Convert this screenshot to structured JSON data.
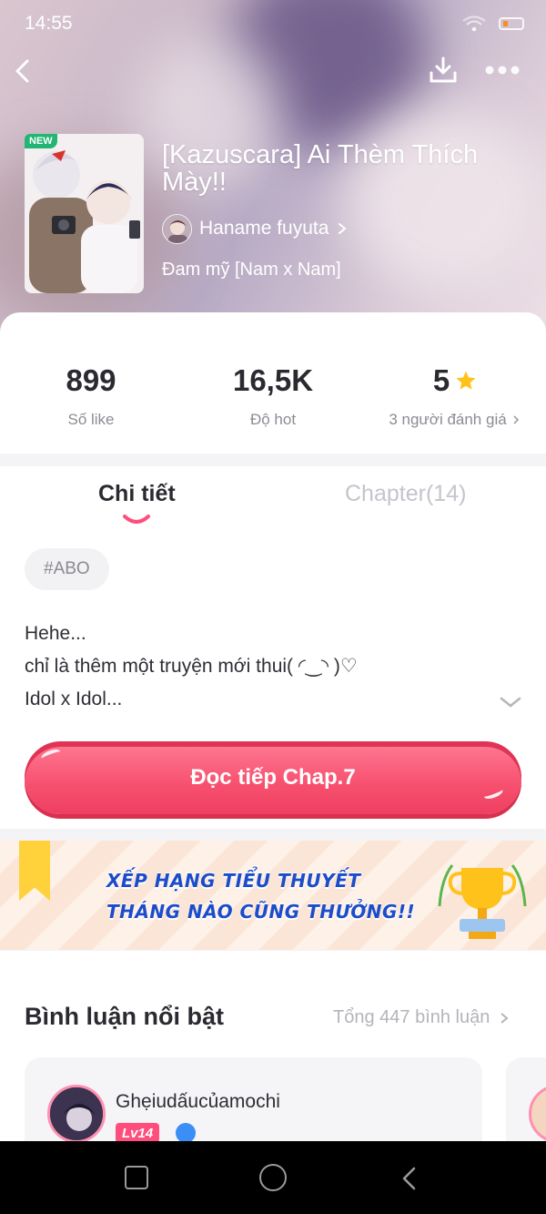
{
  "status_bar": {
    "time": "14:55"
  },
  "book": {
    "badge": "NEW",
    "title": "[Kazuscara] Ai Thèm Thích Mày!!",
    "author": "Haname fuyuta",
    "genre": "Đam mỹ [Nam x Nam]"
  },
  "stats": [
    {
      "value": "899",
      "label": "Số like"
    },
    {
      "value": "16,5K",
      "label": "Độ hot"
    },
    {
      "value": "5",
      "label": "3 người đánh giá",
      "rating": 5
    }
  ],
  "tabs": {
    "detail": "Chi tiết",
    "chapters": "Chapter(14)"
  },
  "tag": "#ABO",
  "description": {
    "line1": "Hehe...",
    "line2": "chỉ là thêm một truyện mới thui( ◜‿◝ )♡",
    "line3": "Idol x Idol..."
  },
  "read_button": "Đọc tiếp Chap.7",
  "banner": {
    "line1": "XẾP HẠNG TIỂU THUYẾT",
    "line2": "THÁNG NÀO CŨNG THƯỞNG!!"
  },
  "comments": {
    "title": "Bình luận nổi bật",
    "total": "Tổng 447 bình luận",
    "first": {
      "user": "Ghẹiudấucủamochi",
      "level": "Lv14"
    }
  },
  "colors": {
    "accent": "#f7506f",
    "banner_text": "#1c4cc9",
    "star": "#ffc21a",
    "new_badge": "#22b573"
  }
}
